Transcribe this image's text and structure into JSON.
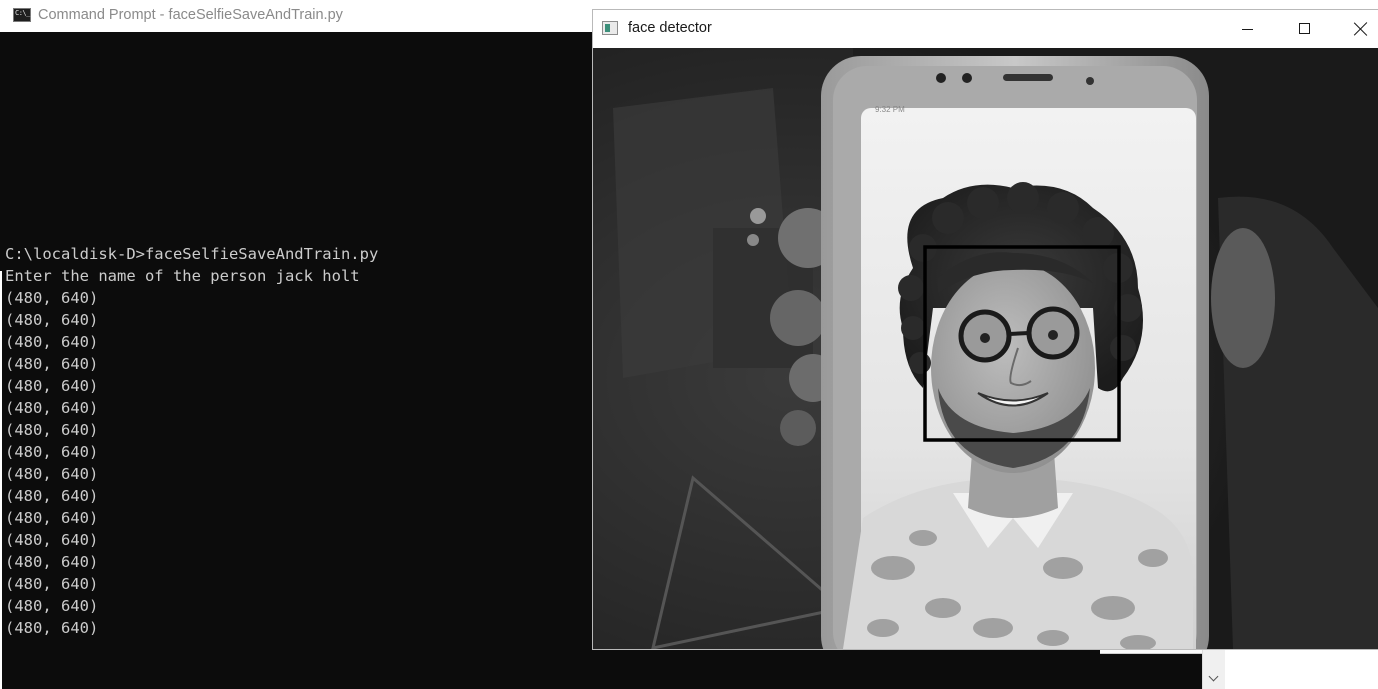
{
  "cmd": {
    "icon_text": "C:\\_",
    "title": "Command Prompt - faceSelfieSaveAndTrain.py",
    "lines": [
      "C:\\localdisk-D>faceSelfieSaveAndTrain.py",
      "Enter the name of the person jack holt",
      "(480, 640)",
      "(480, 640)",
      "(480, 640)",
      "(480, 640)",
      "(480, 640)",
      "(480, 640)",
      "(480, 640)",
      "(480, 640)",
      "(480, 640)",
      "(480, 640)",
      "(480, 640)",
      "(480, 640)",
      "(480, 640)",
      "(480, 640)",
      "(480, 640)",
      "(480, 640)"
    ],
    "background_color": "#0c0c0c",
    "text_color": "#cccccc"
  },
  "face_detector": {
    "title": "face detector",
    "icon": "window-app-icon",
    "controls": [
      "minimize-icon",
      "maximize-icon",
      "close-icon"
    ],
    "image": "grayscale webcam frame showing a phone displaying a photo of a smiling man with curly hair and round glasses",
    "detection_box_color": "#000000"
  }
}
